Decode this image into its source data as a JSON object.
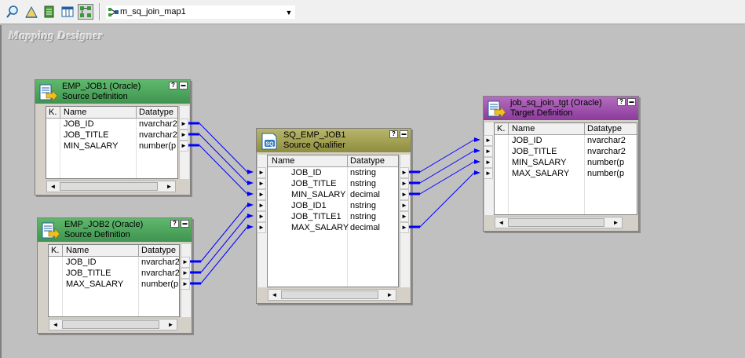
{
  "toolbar": {
    "buttons": [
      {
        "icon": "find-icon"
      },
      {
        "icon": "arrange-icon"
      },
      {
        "icon": "edit-icon"
      },
      {
        "icon": "table-icon"
      },
      {
        "icon": "layout-icon",
        "active": true
      }
    ],
    "mapping_select": {
      "value": "m_sq_join_map1"
    }
  },
  "workspace": {
    "title": "Mapping Designer"
  },
  "column_headers": {
    "key": "K.",
    "name": "Name",
    "datatype": "Datatype"
  },
  "sources": [
    {
      "title": "EMP_JOB1 (Oracle)",
      "subtitle": "Source Definition",
      "rows": [
        {
          "name": "JOB_ID",
          "datatype": "nvarchar2"
        },
        {
          "name": "JOB_TITLE",
          "datatype": "nvarchar2"
        },
        {
          "name": "MIN_SALARY",
          "datatype": "number(p"
        }
      ]
    },
    {
      "title": "EMP_JOB2 (Oracle)",
      "subtitle": "Source Definition",
      "rows": [
        {
          "name": "JOB_ID",
          "datatype": "nvarchar2"
        },
        {
          "name": "JOB_TITLE",
          "datatype": "nvarchar2"
        },
        {
          "name": "MAX_SALARY",
          "datatype": "number(p"
        }
      ]
    }
  ],
  "qualifier": {
    "title": "SQ_EMP_JOB1",
    "subtitle": "Source Qualifier",
    "rows": [
      {
        "name": "JOB_ID",
        "datatype": "nstring"
      },
      {
        "name": "JOB_TITLE",
        "datatype": "nstring"
      },
      {
        "name": "MIN_SALARY",
        "datatype": "decimal"
      },
      {
        "name": "JOB_ID1",
        "datatype": "nstring"
      },
      {
        "name": "JOB_TITLE1",
        "datatype": "nstring"
      },
      {
        "name": "MAX_SALARY",
        "datatype": "decimal"
      }
    ]
  },
  "target": {
    "title": "job_sq_join_tgt (Oracle)",
    "subtitle": "Target Definition",
    "rows": [
      {
        "name": "JOB_ID",
        "datatype": "nvarchar2"
      },
      {
        "name": "JOB_TITLE",
        "datatype": "nvarchar2"
      },
      {
        "name": "MIN_SALARY",
        "datatype": "number(p"
      },
      {
        "name": "MAX_SALARY",
        "datatype": "number(p"
      }
    ]
  },
  "colors": {
    "link": "#0000ff",
    "source_header": "#4fa65e",
    "qualifier_header": "#a6a454",
    "target_header": "#a055ad"
  }
}
